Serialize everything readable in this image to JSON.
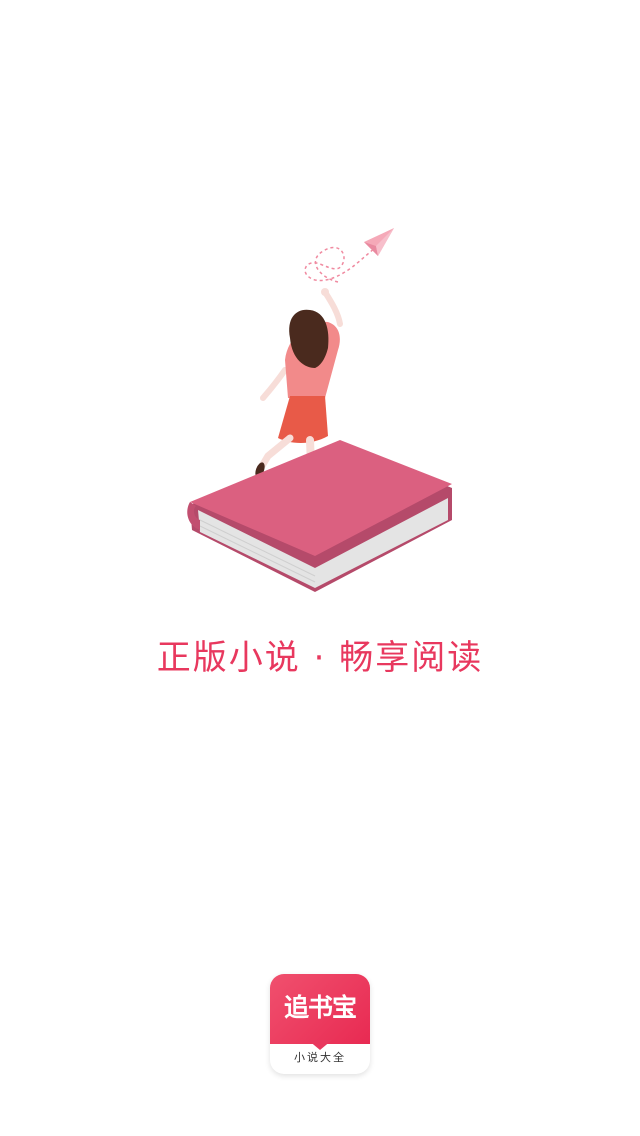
{
  "splash": {
    "slogan": "正版小说 · 畅享阅读",
    "illustration_icon": "girl-on-book-with-paper-plane-illustration"
  },
  "app_logo": {
    "name": "追书宝",
    "subtitle": "小说大全",
    "brand_color": "#e8385e"
  }
}
